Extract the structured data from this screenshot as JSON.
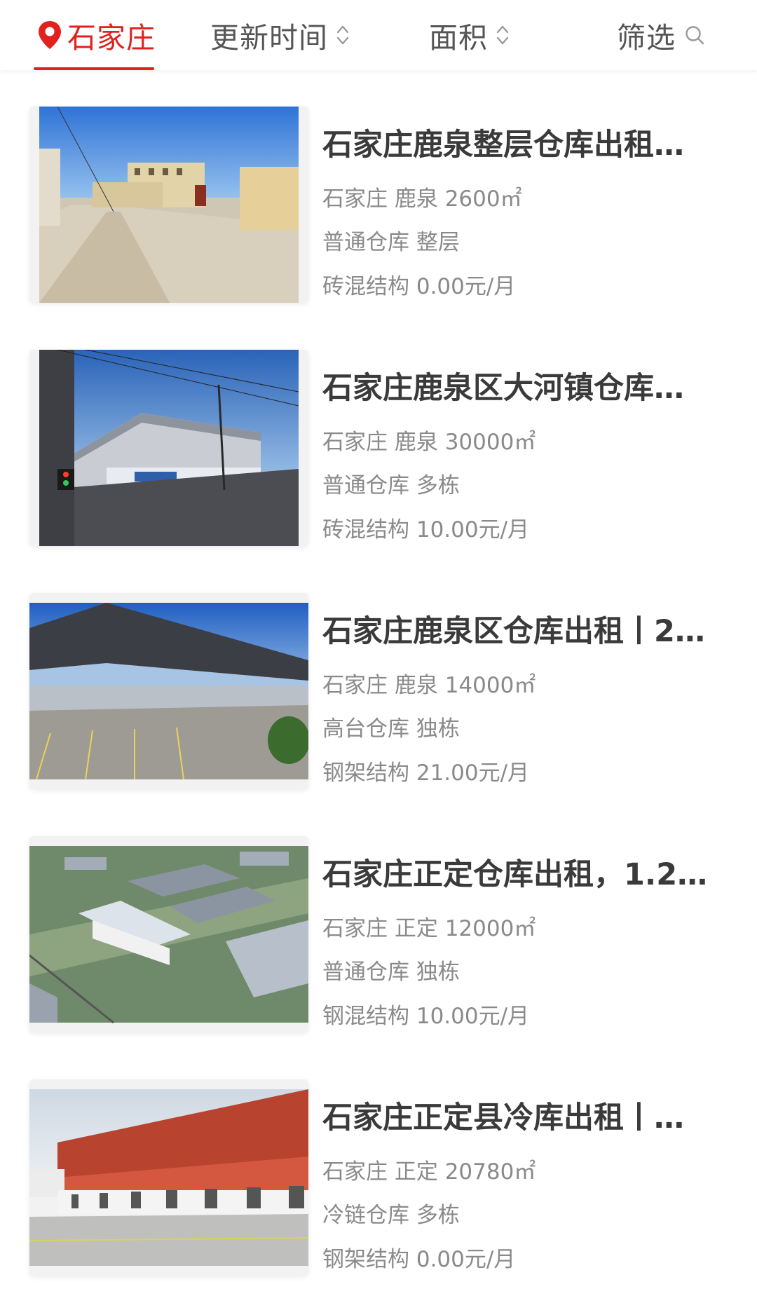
{
  "filter_bar": {
    "city_label": "石家庄",
    "update_time_label": "更新时间",
    "area_label": "面积",
    "filter_label": "筛选",
    "icons": {
      "city": "location-pin-icon",
      "update": "sort-arrows-icon",
      "area": "sort-arrows-icon",
      "filter": "search-icon"
    },
    "accent_color": "#e0211d"
  },
  "listings": [
    {
      "title": "石家庄鹿泉整层仓库出租…",
      "location": "石家庄 鹿泉 2600㎡",
      "type": "普通仓库 整层",
      "structure_price": "砖混结构 0.00元/月"
    },
    {
      "title": "石家庄鹿泉区大河镇仓库…",
      "location": "石家庄 鹿泉 30000㎡",
      "type": "普通仓库 多栋",
      "structure_price": "砖混结构 10.00元/月"
    },
    {
      "title": "石家庄鹿泉区仓库出租丨2…",
      "location": "石家庄 鹿泉 14000㎡",
      "type": "高台仓库 独栋",
      "structure_price": "钢架结构 21.00元/月"
    },
    {
      "title": "石家庄正定仓库出租，1.2…",
      "location": "石家庄 正定 12000㎡",
      "type": "普通仓库 独栋",
      "structure_price": "钢混结构 10.00元/月"
    },
    {
      "title": "石家庄正定县冷库出租丨…",
      "location": "石家庄 正定 20780㎡",
      "type": "冷链仓库 多栋",
      "structure_price": "钢架结构 0.00元/月"
    }
  ]
}
